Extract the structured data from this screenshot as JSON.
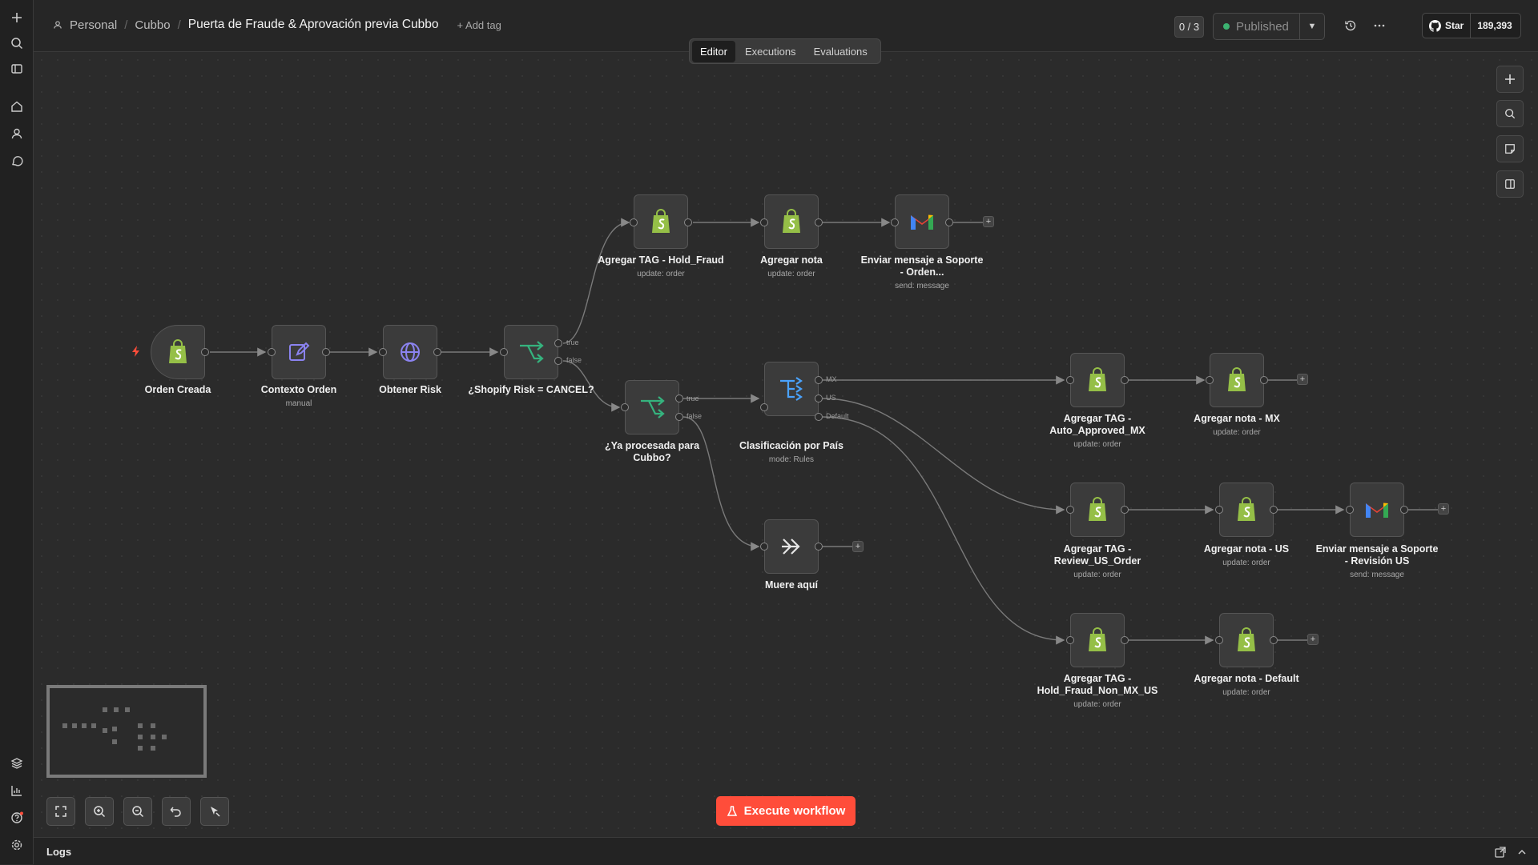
{
  "breadcrumb": {
    "project": "Personal",
    "folder": "Cubbo",
    "workflow": "Puerta de Fraude & Aprovación previa Cubbo",
    "add_tag": "+ Add tag"
  },
  "header": {
    "counter": "0 / 3",
    "published": "Published",
    "github_star": "Star",
    "github_count": "189,393"
  },
  "tabs": [
    {
      "label": "Editor"
    },
    {
      "label": "Executions"
    },
    {
      "label": "Evaluations"
    }
  ],
  "nodes": {
    "orden_creada": {
      "title": "Orden Creada",
      "subtitle": ""
    },
    "contexto": {
      "title": "Contexto Orden",
      "subtitle": "manual"
    },
    "risk": {
      "title": "Obtener Risk",
      "subtitle": ""
    },
    "cancel": {
      "title": "¿Shopify Risk = CANCEL?",
      "subtitle": ""
    },
    "tag_hold": {
      "title": "Agregar TAG - Hold_Fraud",
      "subtitle": "update: order"
    },
    "nota": {
      "title": "Agregar nota",
      "subtitle": "update: order"
    },
    "mail_orden": {
      "title": "Enviar mensaje a Soporte - Orden...",
      "subtitle": "send: message"
    },
    "procesada": {
      "title": "¿Ya procesada para Cubbo?",
      "subtitle": ""
    },
    "clasif": {
      "title": "Clasificación por País",
      "subtitle": "mode: Rules"
    },
    "muere": {
      "title": "Muere aquí",
      "subtitle": ""
    },
    "tag_mx": {
      "title": "Agregar TAG - Auto_Approved_MX",
      "subtitle": "update: order"
    },
    "nota_mx": {
      "title": "Agregar nota - MX",
      "subtitle": "update: order"
    },
    "tag_us": {
      "title": "Agregar TAG - Review_US_Order",
      "subtitle": "update: order"
    },
    "nota_us": {
      "title": "Agregar nota - US",
      "subtitle": "update: order"
    },
    "mail_us": {
      "title": "Enviar mensaje a Soporte - Revisión US",
      "subtitle": "send: message"
    },
    "tag_def": {
      "title": "Agregar TAG - Hold_Fraud_Non_MX_US",
      "subtitle": "update: order"
    },
    "nota_def": {
      "title": "Agregar nota - Default",
      "subtitle": "update: order"
    }
  },
  "branch_labels": {
    "true": "true",
    "false": "false",
    "mx": "MX",
    "us": "US",
    "default": "Default"
  },
  "execute_button": "Execute workflow",
  "logs_label": "Logs",
  "colors": {
    "accent": "#ff4d3a",
    "shopify": "#95bf47",
    "published_dot": "#3cb371",
    "if_node": "#35b37e",
    "switch_node": "#4aa3ff"
  }
}
